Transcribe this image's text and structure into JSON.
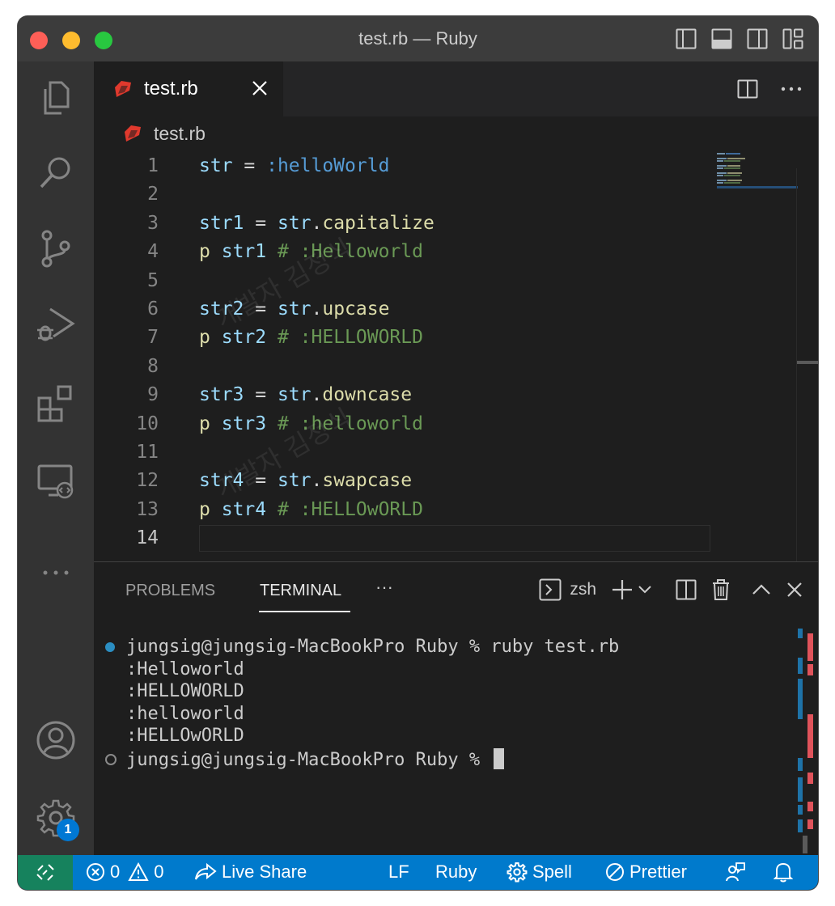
{
  "window": {
    "title": "test.rb — Ruby"
  },
  "tab": {
    "label": "test.rb"
  },
  "breadcrumb": {
    "label": "test.rb"
  },
  "editor": {
    "lines": [
      {
        "num": "1",
        "tokens": [
          [
            "var",
            "str"
          ],
          [
            "op",
            " = "
          ],
          [
            "sym",
            ":helloWorld"
          ]
        ]
      },
      {
        "num": "2",
        "tokens": []
      },
      {
        "num": "3",
        "tokens": [
          [
            "var",
            "str1"
          ],
          [
            "op",
            " = "
          ],
          [
            "var",
            "str"
          ],
          [
            "op",
            "."
          ],
          [
            "fn",
            "capitalize"
          ]
        ]
      },
      {
        "num": "4",
        "tokens": [
          [
            "fn",
            "p"
          ],
          [
            "op",
            " "
          ],
          [
            "var",
            "str1"
          ],
          [
            "cm",
            " # :Helloworld"
          ]
        ]
      },
      {
        "num": "5",
        "tokens": []
      },
      {
        "num": "6",
        "tokens": [
          [
            "var",
            "str2"
          ],
          [
            "op",
            " = "
          ],
          [
            "var",
            "str"
          ],
          [
            "op",
            "."
          ],
          [
            "fn",
            "upcase"
          ]
        ]
      },
      {
        "num": "7",
        "tokens": [
          [
            "fn",
            "p"
          ],
          [
            "op",
            " "
          ],
          [
            "var",
            "str2"
          ],
          [
            "cm",
            " # :HELLOWORLD"
          ]
        ]
      },
      {
        "num": "8",
        "tokens": []
      },
      {
        "num": "9",
        "tokens": [
          [
            "var",
            "str3"
          ],
          [
            "op",
            " = "
          ],
          [
            "var",
            "str"
          ],
          [
            "op",
            "."
          ],
          [
            "fn",
            "downcase"
          ]
        ]
      },
      {
        "num": "10",
        "tokens": [
          [
            "fn",
            "p"
          ],
          [
            "op",
            " "
          ],
          [
            "var",
            "str3"
          ],
          [
            "cm",
            " # :helloworld"
          ]
        ]
      },
      {
        "num": "11",
        "tokens": []
      },
      {
        "num": "12",
        "tokens": [
          [
            "var",
            "str4"
          ],
          [
            "op",
            " = "
          ],
          [
            "var",
            "str"
          ],
          [
            "op",
            "."
          ],
          [
            "fn",
            "swapcase"
          ]
        ]
      },
      {
        "num": "13",
        "tokens": [
          [
            "fn",
            "p"
          ],
          [
            "op",
            " "
          ],
          [
            "var",
            "str4"
          ],
          [
            "cm",
            " # :HELLOwORLD"
          ]
        ]
      },
      {
        "num": "14",
        "tokens": []
      }
    ],
    "active_line": "14",
    "watermark": "개발자 김정식"
  },
  "panel": {
    "tabs": [
      "PROBLEMS",
      "TERMINAL"
    ],
    "active_tab": "TERMINAL",
    "more": "···",
    "shell": "zsh"
  },
  "terminal": {
    "lines": [
      {
        "text": "jungsig@jungsig-MacBookPro Ruby % ruby test.rb",
        "marker": "filled"
      },
      {
        "text": ":Helloworld",
        "marker": ""
      },
      {
        "text": ":HELLOWORLD",
        "marker": ""
      },
      {
        "text": ":helloworld",
        "marker": ""
      },
      {
        "text": ":HELLOwORLD",
        "marker": ""
      },
      {
        "text": "jungsig@jungsig-MacBookPro Ruby % ",
        "marker": "hollow"
      }
    ]
  },
  "activity": {
    "settings_badge": "1"
  },
  "status": {
    "errors": "0",
    "warnings": "0",
    "live_share": "Live Share",
    "eol": "LF",
    "language": "Ruby",
    "spell": "Spell",
    "prettier": "Prettier"
  },
  "colors": {
    "accent": "#007acc",
    "remote": "#16825d",
    "ruby_red": "#e0392d",
    "var": "#9cdcfe",
    "func": "#dcdcaa",
    "symbol": "#569cd6",
    "comment": "#6a9955"
  }
}
